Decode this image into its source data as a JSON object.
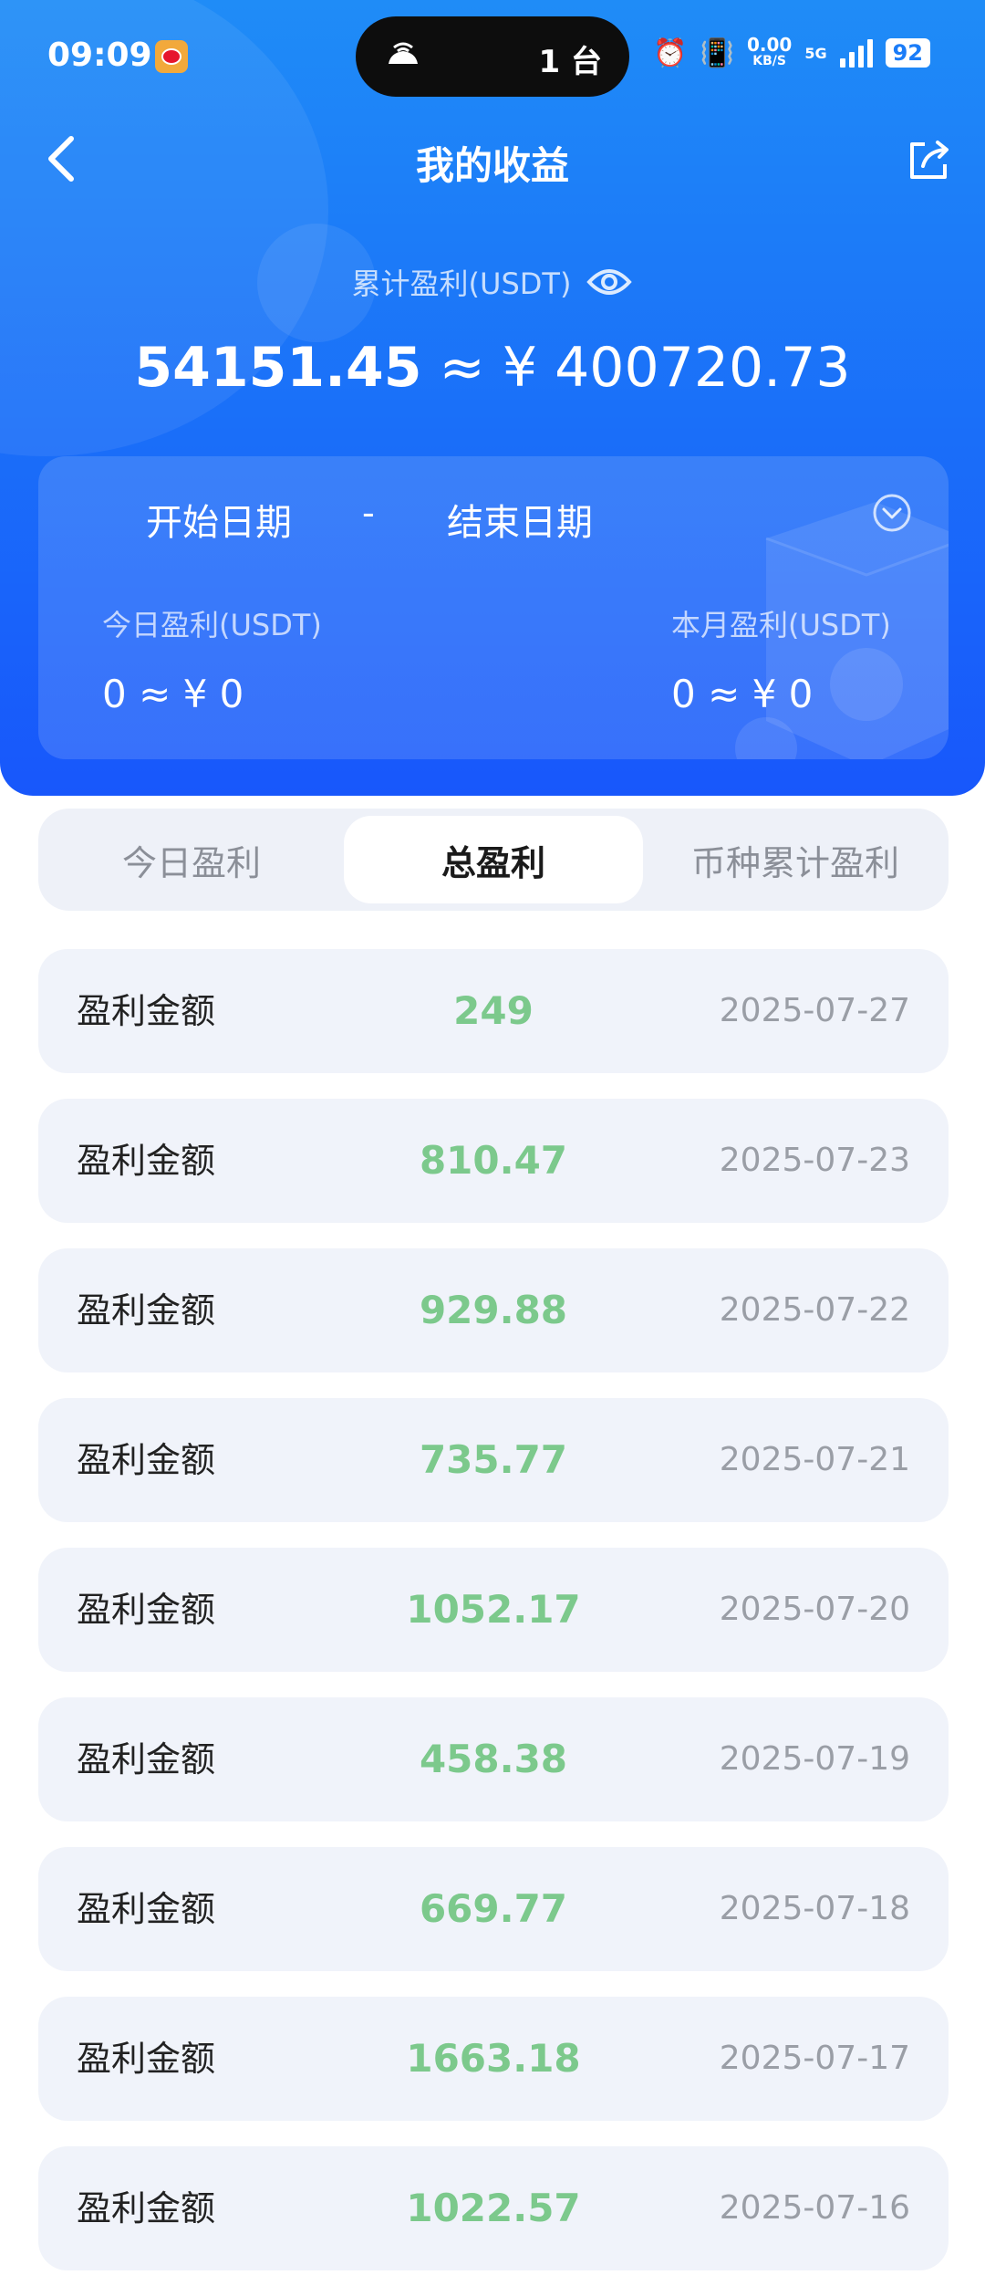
{
  "status_bar": {
    "time": "09:09",
    "island_text": "1 台",
    "net_speed": "0.00",
    "net_unit": "KB/S",
    "signal_type": "5G",
    "battery": "92"
  },
  "nav": {
    "title": "我的收益"
  },
  "summary": {
    "cumulative_label": "累计盈利(USDT)",
    "cumulative_usdt": "54151.45",
    "approx": "≈",
    "cumulative_cny": "¥ 400720.73"
  },
  "date_filter": {
    "start_label": "开始日期",
    "separator": "-",
    "end_label": "结束日期"
  },
  "stats": {
    "today_label": "今日盈利(USDT)",
    "today_value": "0 ≈ ¥ 0",
    "month_label": "本月盈利(USDT)",
    "month_value": "0 ≈ ¥ 0"
  },
  "tabs": [
    {
      "label": "今日盈利"
    },
    {
      "label": "总盈利",
      "active": true
    },
    {
      "label": "币种累计盈利"
    }
  ],
  "records": [
    {
      "label": "盈利金额",
      "amount": "249",
      "date": "2025-07-27"
    },
    {
      "label": "盈利金额",
      "amount": "810.47",
      "date": "2025-07-23"
    },
    {
      "label": "盈利金额",
      "amount": "929.88",
      "date": "2025-07-22"
    },
    {
      "label": "盈利金额",
      "amount": "735.77",
      "date": "2025-07-21"
    },
    {
      "label": "盈利金额",
      "amount": "1052.17",
      "date": "2025-07-20"
    },
    {
      "label": "盈利金额",
      "amount": "458.38",
      "date": "2025-07-19"
    },
    {
      "label": "盈利金额",
      "amount": "669.77",
      "date": "2025-07-18"
    },
    {
      "label": "盈利金额",
      "amount": "1663.18",
      "date": "2025-07-17"
    },
    {
      "label": "盈利金额",
      "amount": "1022.57",
      "date": "2025-07-16"
    }
  ],
  "colors": {
    "header_top": "#1f8cf7",
    "header_bottom": "#1857fb",
    "amount_green": "#7cc98c",
    "row_bg": "#f0f3fa"
  }
}
